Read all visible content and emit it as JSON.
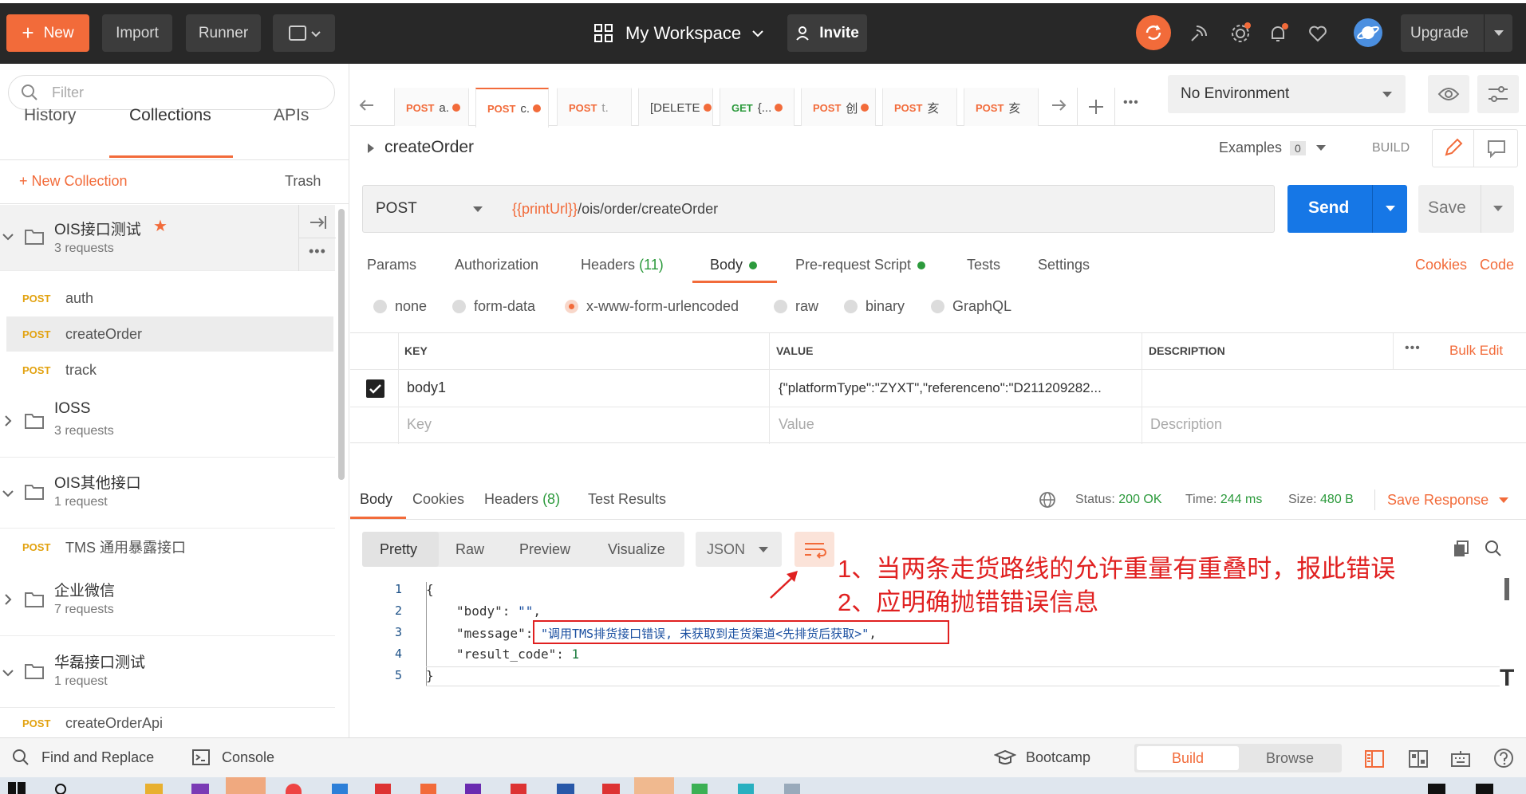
{
  "topbar": {
    "new_label": "New",
    "import_label": "Import",
    "runner_label": "Runner",
    "workspace_label": "My Workspace",
    "invite_label": "Invite",
    "upgrade_label": "Upgrade",
    "accent": "#f26b3a"
  },
  "sidebar": {
    "filter_placeholder": "Filter",
    "tabs": [
      "History",
      "Collections",
      "APIs"
    ],
    "new_collection": "+ New Collection",
    "trash": "Trash",
    "collections": [
      {
        "name": "OIS接口测试",
        "count": "3 requests",
        "starred": true,
        "requests": [
          {
            "method": "POST",
            "name": "auth"
          },
          {
            "method": "POST",
            "name": "createOrder"
          },
          {
            "method": "POST",
            "name": "track"
          }
        ]
      },
      {
        "name": "IOSS",
        "count": "3 requests"
      },
      {
        "name": "OIS其他接口",
        "count": "1 request",
        "requests": [
          {
            "method": "POST",
            "name": "TMS 通用暴露接口"
          }
        ]
      },
      {
        "name": "企业微信",
        "count": "7 requests"
      },
      {
        "name": "华磊接口测试",
        "count": "1 request",
        "requests": [
          {
            "method": "POST",
            "name": "createOrderApi"
          }
        ]
      }
    ]
  },
  "tabs": [
    {
      "method": "POST",
      "label": "a."
    },
    {
      "method": "POST",
      "label": "c."
    },
    {
      "method": "POST",
      "label": "t."
    },
    {
      "method": "",
      "label": "[DELETE"
    },
    {
      "method": "GET",
      "label": "{..."
    },
    {
      "method": "POST",
      "label": "创"
    },
    {
      "method": "POST",
      "label": "亥"
    },
    {
      "method": "POST",
      "label": "亥"
    }
  ],
  "environment": "No Environment",
  "request": {
    "name": "createOrder",
    "examples_label": "Examples",
    "examples_count": "0",
    "build_label": "BUILD",
    "method": "POST",
    "url_var": "{{printUrl}}",
    "url_path": "/ois/order/createOrder",
    "send_label": "Send",
    "save_label": "Save"
  },
  "subtabs": {
    "params": "Params",
    "authorization": "Authorization",
    "headers": "Headers",
    "headers_count": "(11)",
    "body": "Body",
    "prerequest": "Pre-request Script",
    "tests": "Tests",
    "settings": "Settings",
    "cookies": "Cookies",
    "code": "Code"
  },
  "body_types": [
    "none",
    "form-data",
    "x-www-form-urlencoded",
    "raw",
    "binary",
    "GraphQL"
  ],
  "kv_table": {
    "headers": [
      "KEY",
      "VALUE",
      "DESCRIPTION"
    ],
    "bulk_edit": "Bulk Edit",
    "row": {
      "key": "body1",
      "value": "{\"platformType\":\"ZYXT\",\"referenceno\":\"D211209282..."
    },
    "placeholders": {
      "key": "Key",
      "value": "Value",
      "description": "Description"
    }
  },
  "response": {
    "tabs": {
      "body": "Body",
      "cookies": "Cookies",
      "headers": "Headers",
      "headers_count": "(8)",
      "tests": "Test Results"
    },
    "status_label": "Status:",
    "status_value": "200 OK",
    "time_label": "Time:",
    "time_value": "244 ms",
    "size_label": "Size:",
    "size_value": "480 B",
    "save_response": "Save Response",
    "views": [
      "Pretty",
      "Raw",
      "Preview",
      "Visualize"
    ],
    "format": "JSON",
    "code": {
      "l1": "{",
      "l2_key": "\"body\"",
      "l2_val": "\"\"",
      "l3_key": "\"message\"",
      "l3_val": "\"调用TMS排货接口错误, 未获取到走货渠道<先排货后获取>\"",
      "l4_key": "\"result_code\"",
      "l4_val": "1",
      "l5": "}"
    },
    "line_numbers": [
      "1",
      "2",
      "3",
      "4",
      "5"
    ]
  },
  "annotation": {
    "line1": "1、当两条走货路线的允许重量有重叠时，报此错误",
    "line2": "2、应明确抛错错误信息",
    "color": "#e02020"
  },
  "statusbar": {
    "find_replace": "Find and Replace",
    "console": "Console",
    "bootcamp": "Bootcamp",
    "build": "Build",
    "browse": "Browse"
  }
}
